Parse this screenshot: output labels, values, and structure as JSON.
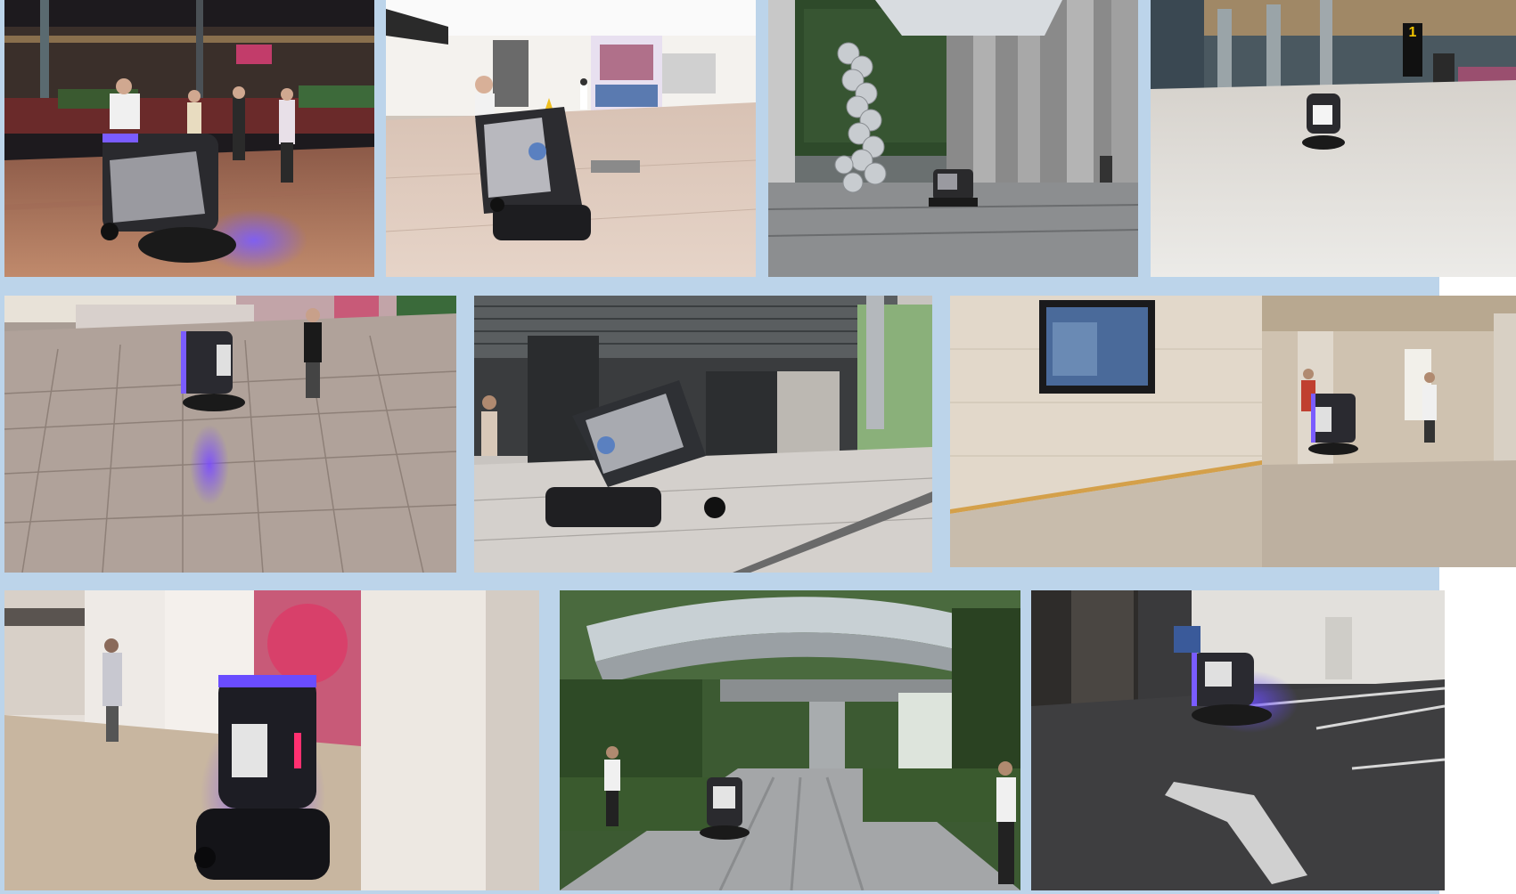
{
  "collage": {
    "background_color": "#bcd4ea",
    "photos": [
      {
        "id": "p1",
        "scene": "night-plaza",
        "robot_glow": "#6a4dff"
      },
      {
        "id": "p2",
        "scene": "indoor-hall",
        "robot_glow": "#6a4dff"
      },
      {
        "id": "p3",
        "scene": "sculpture-courtyard",
        "robot_glow": "#6a4dff"
      },
      {
        "id": "p4",
        "scene": "airport-terminal",
        "robot_glow": "#6a4dff",
        "gate_sign": "1"
      },
      {
        "id": "p5",
        "scene": "tiled-corridor",
        "robot_glow": "#6a4dff"
      },
      {
        "id": "p6",
        "scene": "building-exterior",
        "robot_glow": "#6a4dff"
      },
      {
        "id": "p7",
        "scene": "marble-lobby",
        "robot_glow": "#6a4dff"
      },
      {
        "id": "p8",
        "scene": "gallery-wall",
        "robot_glow": "#6a4dff"
      },
      {
        "id": "p9",
        "scene": "garden-walkway",
        "robot_glow": "#6a4dff"
      },
      {
        "id": "p10",
        "scene": "car-park",
        "robot_glow": "#6a4dff"
      }
    ]
  }
}
